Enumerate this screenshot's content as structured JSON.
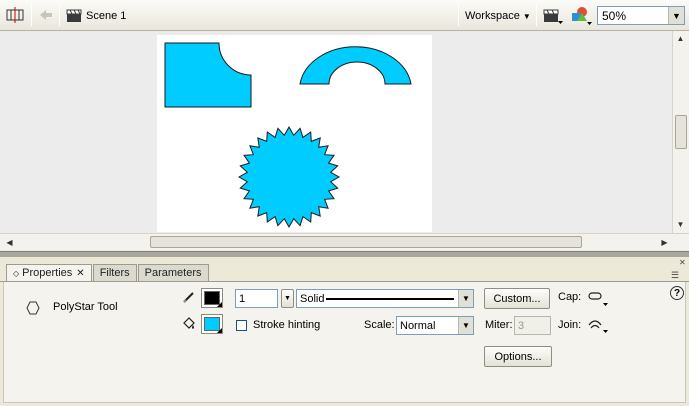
{
  "toolbar": {
    "scene_label": "Scene 1",
    "workspace_label": "Workspace",
    "zoom_value": "50%",
    "icons": [
      "timeline-icon",
      "back-arrow-icon",
      "scene-clapper-icon",
      "edit-scene-icon",
      "edit-symbols-icon"
    ]
  },
  "stage": {
    "shape_fill": "#00ccff",
    "shapes": [
      "rounded-cutout-rectangle",
      "half-ring",
      "starburst"
    ]
  },
  "panel": {
    "tabs": [
      {
        "label": "Properties",
        "active": true
      },
      {
        "label": "Filters",
        "active": false
      },
      {
        "label": "Parameters",
        "active": false
      }
    ],
    "tool_name": "PolyStar Tool",
    "stroke_color": "#000000",
    "fill_color": "#00ccff",
    "stroke_height": "1",
    "stroke_style": "Solid",
    "custom_button": "Custom...",
    "cap_label": "Cap:",
    "stroke_hinting_label": "Stroke hinting",
    "stroke_hinting_checked": false,
    "scale_label": "Scale:",
    "scale_value": "Normal",
    "miter_label": "Miter:",
    "miter_value": "3",
    "join_label": "Join:",
    "options_button": "Options...",
    "help_icon": "?"
  }
}
